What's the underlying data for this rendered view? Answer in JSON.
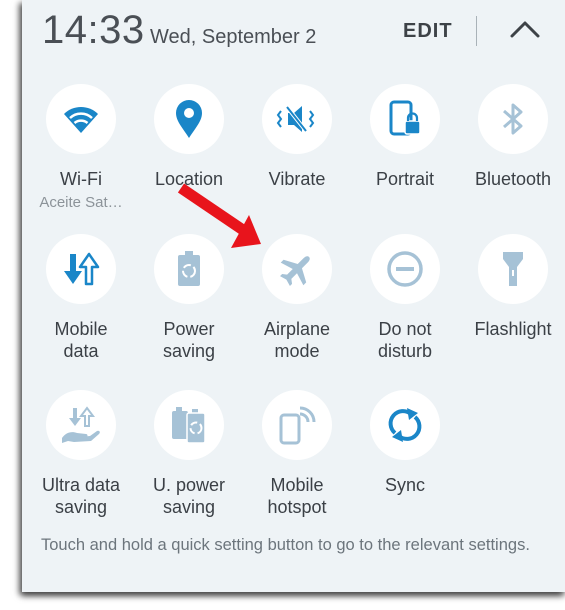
{
  "header": {
    "time": "14:33",
    "date": "Wed, September 2",
    "edit_label": "EDIT"
  },
  "tiles": [
    {
      "label": "Wi-Fi",
      "sublabel": "Aceite Sat…",
      "icon": "wifi-icon",
      "active": true
    },
    {
      "label": "Location",
      "icon": "location-pin-icon",
      "active": true
    },
    {
      "label": "Vibrate",
      "icon": "vibrate-icon",
      "active": true
    },
    {
      "label": "Portrait",
      "icon": "portrait-lock-icon",
      "active": true
    },
    {
      "label": "Bluetooth",
      "icon": "bluetooth-icon",
      "active": false
    },
    {
      "label": "Mobile\ndata",
      "icon": "mobile-data-icon",
      "active": true
    },
    {
      "label": "Power\nsaving",
      "icon": "power-saving-icon",
      "active": false
    },
    {
      "label": "Airplane\nmode",
      "icon": "airplane-icon",
      "active": false
    },
    {
      "label": "Do not\ndisturb",
      "icon": "do-not-disturb-icon",
      "active": false
    },
    {
      "label": "Flashlight",
      "icon": "flashlight-icon",
      "active": false
    },
    {
      "label": "Ultra data\nsaving",
      "icon": "ultra-data-saving-icon",
      "active": false
    },
    {
      "label": "U. power\nsaving",
      "icon": "ultra-power-saving-icon",
      "active": false
    },
    {
      "label": "Mobile\nhotspot",
      "icon": "mobile-hotspot-icon",
      "active": false
    },
    {
      "label": "Sync",
      "icon": "sync-icon",
      "active": true
    }
  ],
  "hint": "Touch and hold a quick setting button to go to the relevant settings.",
  "colors": {
    "active": "#1a86c8",
    "inactive": "#a6c2d6",
    "panel": "#eef3f6",
    "annotation_arrow": "#e8141c"
  }
}
